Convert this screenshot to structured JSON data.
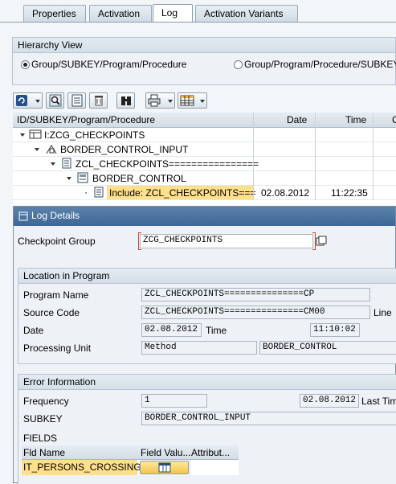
{
  "tabs": [
    {
      "label": "Properties"
    },
    {
      "label": "Activation"
    },
    {
      "label": "Log"
    },
    {
      "label": "Activation Variants"
    }
  ],
  "hierarchy": {
    "title": "Hierarchy View",
    "option1": "Group/SUBKEY/Program/Procedure",
    "option2": "Group/Program/Procedure/SUBKEY"
  },
  "table": {
    "col_id": "ID/SUBKEY/Program/Procedure",
    "col_date": "Date",
    "col_time": "Time",
    "col_extra": "C",
    "rows": [
      {
        "label": "I:ZCG_CHECKPOINTS",
        "date": "",
        "time": ""
      },
      {
        "label": "BORDER_CONTROL_INPUT",
        "date": "",
        "time": ""
      },
      {
        "label": "ZCL_CHECKPOINTS================",
        "date": "",
        "time": ""
      },
      {
        "label": "BORDER_CONTROL",
        "date": "",
        "time": ""
      },
      {
        "label": "Include: ZCL_CHECKPOINTS===",
        "date": "02.08.2012",
        "time": "11:22:35"
      }
    ]
  },
  "dialog": {
    "title": "Log Details",
    "checkpoint_group_label": "Checkpoint Group",
    "checkpoint_group_value": "ZCG_CHECKPOINTS",
    "location": {
      "title": "Location in Program",
      "program_name_label": "Program Name",
      "program_name_value": "ZCL_CHECKPOINTS===============CP",
      "source_code_label": "Source Code",
      "source_code_value": "ZCL_CHECKPOINTS===============CM00",
      "line_label": "Line",
      "date_label": "Date",
      "date_value": "02.08.2012",
      "time_label": "Time",
      "time_value": "11:10:02",
      "unit_label": "Processing Unit",
      "unit_type_value": "Method",
      "unit_name_value": "BORDER_CONTROL"
    },
    "error": {
      "title": "Error Information",
      "frequency_label": "Frequency",
      "frequency_value": "1",
      "last_date_value": "02.08.2012",
      "last_time_label": "Last Tim",
      "subkey_label": "SUBKEY",
      "subkey_value": "BORDER_CONTROL_INPUT",
      "fields_label": "FIELDS",
      "col_fld_name": "Fld Name",
      "col_field_value": "Field Valu...",
      "col_attribute": "Attribut...",
      "field_row_name": "IT_PERSONS_CROSSING"
    }
  },
  "colors": {
    "title_bar": "#4a73a0",
    "highlight": "#ffe08a",
    "required_marker": "#d9432e"
  }
}
